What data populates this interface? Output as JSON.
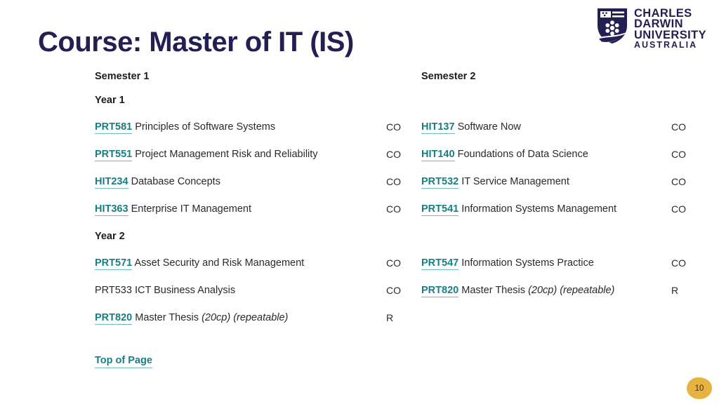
{
  "title": "Course: Master of IT (IS)",
  "logo": {
    "name": "charles-darwin-university-logo",
    "line1": "CHARLES",
    "line2": "DARWIN",
    "line3": "UNIVERSITY",
    "line4": "AUSTRALIA",
    "color": "#241f52"
  },
  "colors": {
    "title": "#241f52",
    "link": "#177f84",
    "link_underline": "#6fb7ba",
    "text": "#2a2a2e",
    "rule": "#e9e9ec",
    "badge_bg": "#e5b33f",
    "page_bg": "#ffffff"
  },
  "table": {
    "headers": {
      "semester1": "Semester 1",
      "semester2": "Semester 2"
    },
    "years": [
      {
        "label": "Year 1",
        "rows": [
          {
            "left": {
              "code": "PRT581",
              "link": true,
              "name": "Principles of Software Systems",
              "note": "",
              "type": "CO"
            },
            "right": {
              "code": "HIT137",
              "link": true,
              "name": "Software Now",
              "note": "",
              "type": "CO"
            }
          },
          {
            "left": {
              "code": "PRT551",
              "link": true,
              "name": "Project Management Risk and Reliability",
              "note": "",
              "type": "CO"
            },
            "right": {
              "code": "HIT140",
              "link": true,
              "name": "Foundations of Data Science",
              "note": "",
              "type": "CO"
            }
          },
          {
            "left": {
              "code": "HIT234",
              "link": true,
              "name": "Database Concepts",
              "note": "",
              "type": "CO"
            },
            "right": {
              "code": "PRT532",
              "link": true,
              "name": "IT Service Management",
              "note": "",
              "type": "CO"
            }
          },
          {
            "left": {
              "code": "HIT363",
              "link": true,
              "name": "Enterprise IT Management",
              "note": "",
              "type": "CO"
            },
            "right": {
              "code": "PRT541",
              "link": true,
              "name": "Information Systems Management",
              "note": "",
              "type": "CO"
            }
          }
        ]
      },
      {
        "label": "Year 2",
        "rows": [
          {
            "left": {
              "code": "PRT571",
              "link": true,
              "name": "Asset Security and Risk Management",
              "note": "",
              "type": "CO"
            },
            "right": {
              "code": "PRT547",
              "link": true,
              "name": "Information Systems Practice",
              "note": "",
              "type": "CO"
            }
          },
          {
            "left": {
              "code": "PRT533",
              "link": false,
              "name": "ICT Business Analysis",
              "note": "",
              "type": "CO"
            },
            "right": {
              "code": "PRT820",
              "link": true,
              "name": "Master Thesis",
              "note": "(20cp) (repeatable)",
              "type": "R"
            }
          },
          {
            "left": {
              "code": "PRT820",
              "link": true,
              "name": "Master Thesis",
              "note": "(20cp) (repeatable)",
              "type": "R"
            },
            "right": {
              "code": "",
              "link": false,
              "name": "",
              "note": "",
              "type": ""
            }
          }
        ]
      }
    ]
  },
  "footer": {
    "top_of_page": "Top of Page"
  },
  "page_number": "10"
}
